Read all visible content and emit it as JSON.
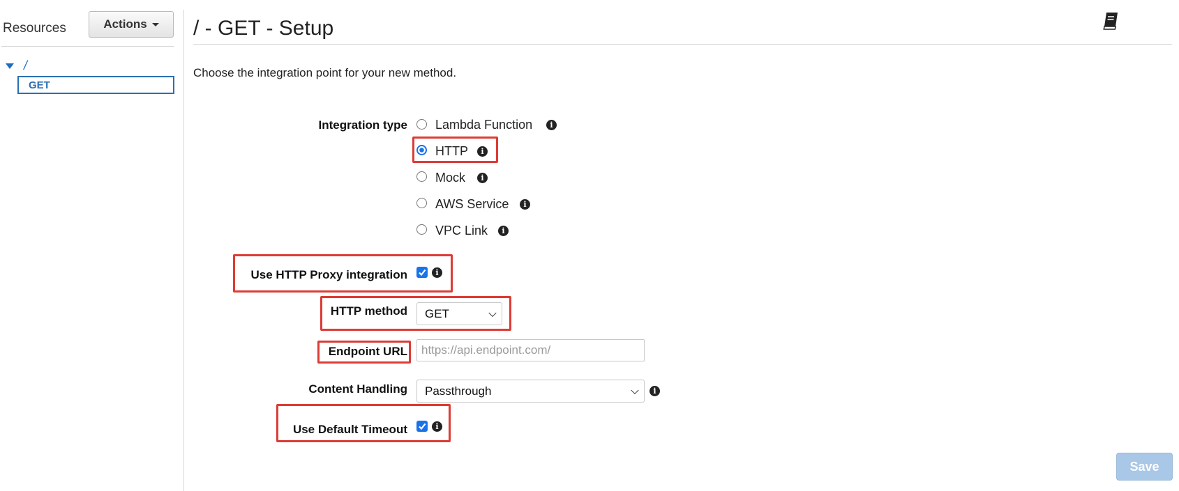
{
  "sidebar": {
    "title": "Resources",
    "actions_label": "Actions",
    "tree_root": "/",
    "tree_selected": "GET"
  },
  "header": {
    "title": "/ - GET - Setup",
    "help_icon": "book-icon"
  },
  "intro_text": "Choose the integration point for your new method.",
  "form": {
    "integration_type": {
      "label": "Integration type",
      "selected": "HTTP",
      "options": [
        {
          "label": "Lambda Function"
        },
        {
          "label": "HTTP"
        },
        {
          "label": "Mock"
        },
        {
          "label": "AWS Service"
        },
        {
          "label": "VPC Link"
        }
      ]
    },
    "http_proxy": {
      "label": "Use HTTP Proxy integration",
      "checked": true
    },
    "http_method": {
      "label": "HTTP method",
      "value": "GET"
    },
    "endpoint_url": {
      "label": "Endpoint URL",
      "placeholder": "https://api.endpoint.com/",
      "value": ""
    },
    "content_handling": {
      "label": "Content Handling",
      "value": "Passthrough"
    },
    "default_timeout": {
      "label": "Use Default Timeout",
      "checked": true
    }
  },
  "save_label": "Save",
  "colors": {
    "accent": "#1a73e8",
    "link": "#1f6cbf",
    "highlight_box": "#dd3b35",
    "save_button": "#a9c7e6"
  }
}
